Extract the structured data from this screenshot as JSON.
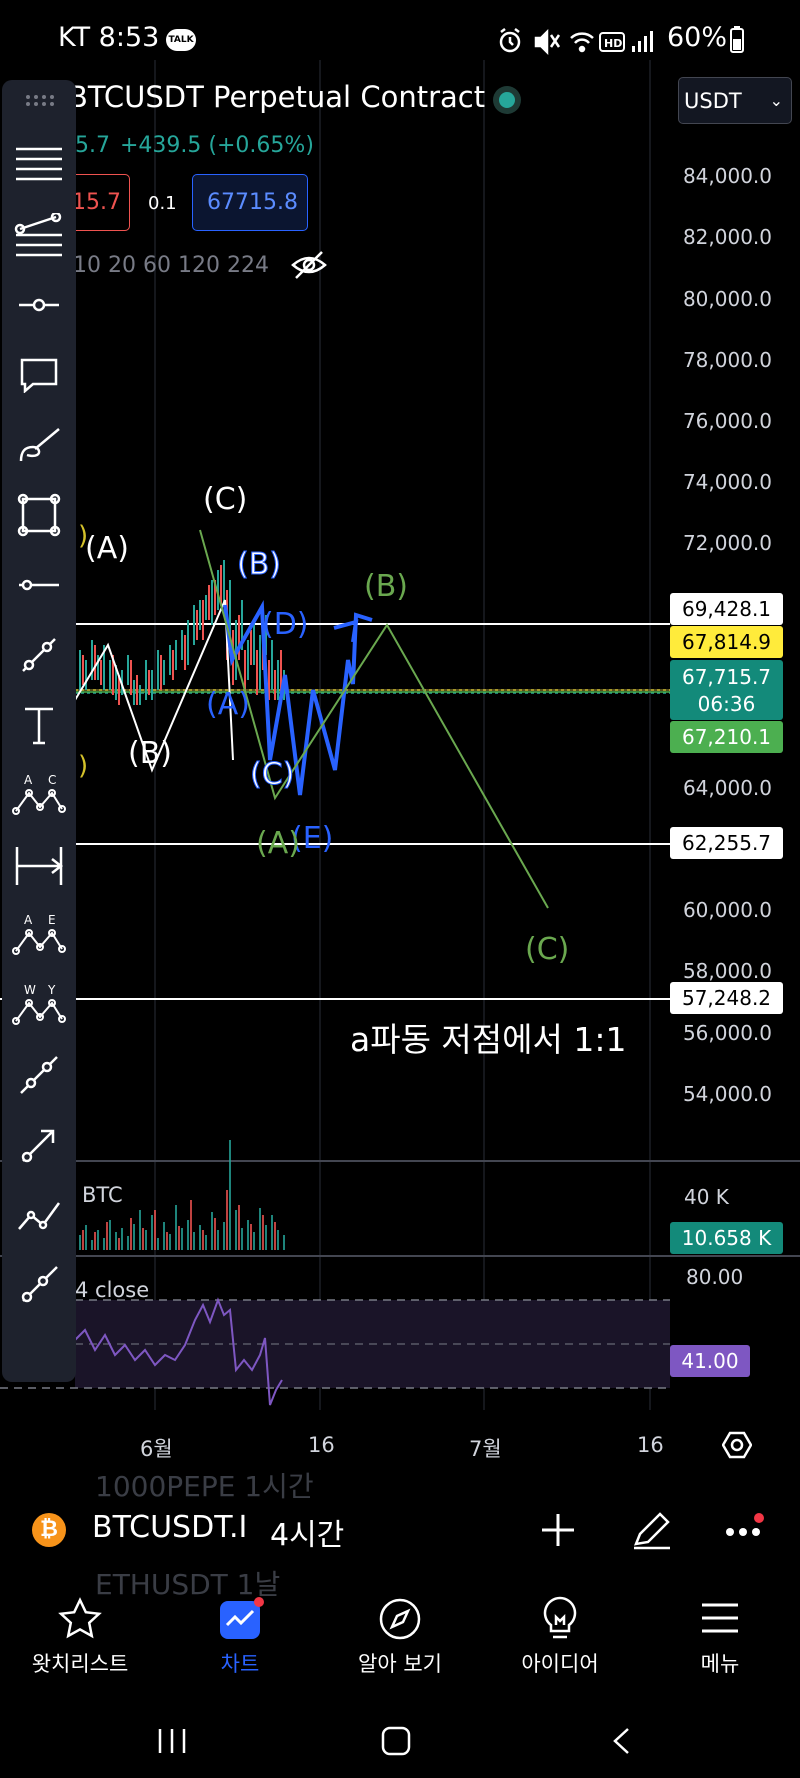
{
  "status_bar": {
    "carrier_time": "KT 8:53",
    "talk_badge": "TALK",
    "battery": "60%"
  },
  "header": {
    "title": "BTCUSDT Perpetual Contract",
    "price_partial": "5.7",
    "change": "+439.5 (+0.65%)",
    "sell_price_partial": "15.7",
    "spread": "0.1",
    "buy_price": "67715.8",
    "ma_periods": "10 20 60 120 224",
    "currency": "USDT"
  },
  "price_axis": [
    "84,000.0",
    "82,000.0",
    "80,000.0",
    "78,000.0",
    "76,000.0",
    "74,000.0",
    "72,000.0",
    "64,000.0",
    "60,000.0",
    "58,000.0",
    "56,000.0",
    "54,000.0"
  ],
  "price_tags": {
    "line1": "69,428.1",
    "mark": "67,814.9",
    "last": "67,715.7",
    "countdown": "06:36",
    "low": "67,210.1",
    "line2": "62,255.7",
    "line3": "57,248.2"
  },
  "wave_labels": {
    "white_c": "(C)",
    "white_a": "(A)",
    "white_b": "(B)",
    "blue_b": "(B)",
    "blue_d": "(D)",
    "blue_a": "(A)",
    "blue_c": "(C)",
    "blue_e": "(E)",
    "green_b": "(B)",
    "green_a": "(A)",
    "green_c": "(C)",
    "yellow_partial": ")"
  },
  "annotation": "a파동 저점에서 1:1",
  "volume": {
    "label": "BTC",
    "scale": "40 K",
    "value": "10.658 K"
  },
  "rsi": {
    "label": "4 close",
    "upper": "80.00",
    "value": "41.00"
  },
  "date_axis": [
    "6월",
    "16",
    "7월",
    "16"
  ],
  "symbol_bar": {
    "symbol": "BTCUSDT.I",
    "timeframe": "4시간",
    "ghost_above": "1000PEPE 1시간",
    "ghost_below": "ETHUSDT 1날"
  },
  "bottom_nav": [
    {
      "label": "왓치리스트",
      "icon": "star-icon"
    },
    {
      "label": "차트",
      "icon": "chart-icon"
    },
    {
      "label": "알아 보기",
      "icon": "compass-icon"
    },
    {
      "label": "아이디어",
      "icon": "lightbulb-icon"
    },
    {
      "label": "메뉴",
      "icon": "menu-icon"
    }
  ],
  "colors": {
    "green": "#26a69a",
    "red": "#ef5350",
    "blue": "#2962ff",
    "yellow": "#ffeb3b",
    "wave_green": "#6aa84f",
    "rsi_purple": "#7e57c2"
  }
}
